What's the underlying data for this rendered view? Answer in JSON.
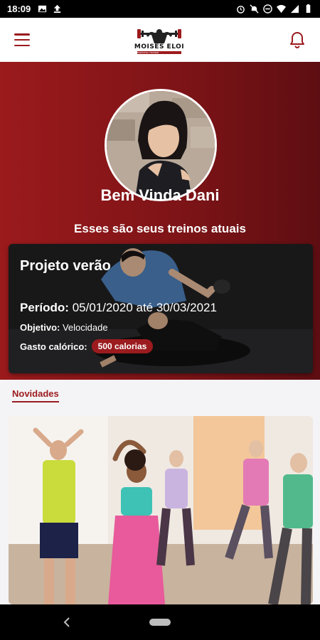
{
  "status_bar": {
    "time": "18:09",
    "left_icons": [
      "image-icon",
      "upload-icon"
    ],
    "right_icons": [
      "alarm-icon",
      "notifications-off-icon",
      "do-not-disturb-icon",
      "wifi-icon",
      "signal-icon",
      "battery-icon"
    ]
  },
  "app_bar": {
    "menu_icon": "menu-icon",
    "logo_text": "MOISES ELOI",
    "logo_subtext": "PERSONAL TRAINER",
    "notification_icon": "bell-icon"
  },
  "hero": {
    "greeting": "Bem Vinda Dani",
    "subtitle": "Esses são seus treinos atuais"
  },
  "workout_card": {
    "title": "Projeto verão",
    "period_label": "Período:",
    "period_value": "05/01/2020 até 30/03/2021",
    "objective_label": "Objetivo:",
    "objective_value": "Velocidade",
    "calories_label": "Gasto calórico:",
    "calories_value": "500 calorias"
  },
  "news": {
    "label": "Novidades"
  },
  "colors": {
    "brand": "#9b1b1e",
    "hero_gradient_start": "#9b1a1c",
    "hero_gradient_end": "#5e0e12"
  }
}
